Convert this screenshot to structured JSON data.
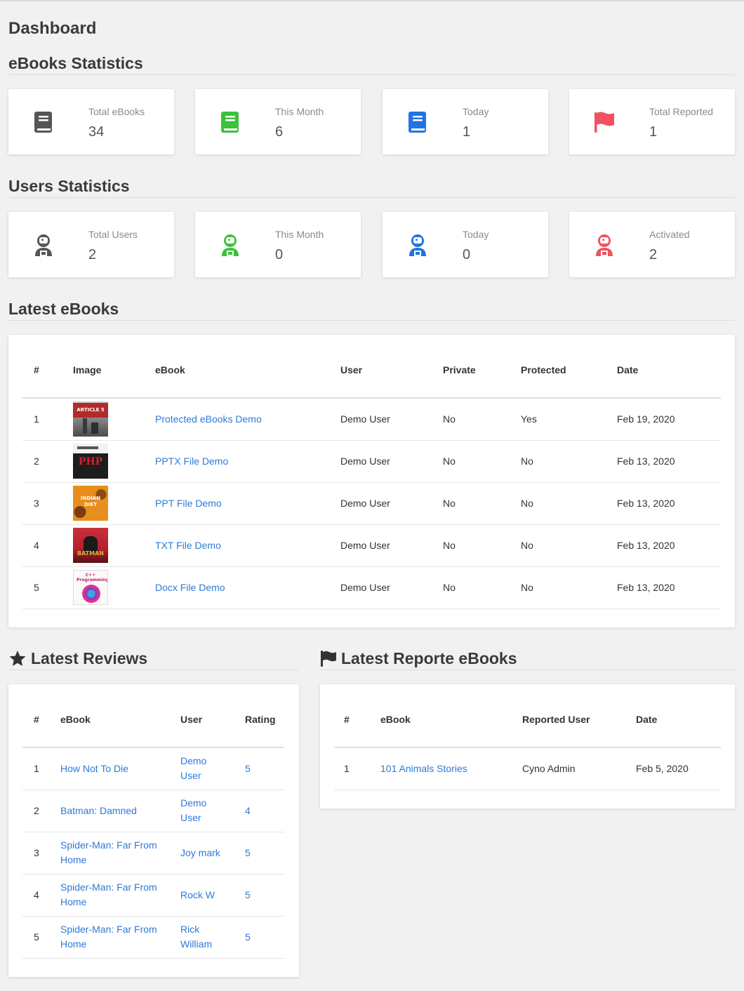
{
  "page_title": "Dashboard",
  "ebooks_stats": {
    "title": "eBooks Statistics",
    "cards": [
      {
        "label": "Total eBooks",
        "value": "34",
        "icon": "book-icon",
        "color": "#555555"
      },
      {
        "label": "This Month",
        "value": "6",
        "icon": "book-icon",
        "color": "#3cc13b"
      },
      {
        "label": "Today",
        "value": "1",
        "icon": "book-icon",
        "color": "#2173e4"
      },
      {
        "label": "Total Reported",
        "value": "1",
        "icon": "flag-icon",
        "color": "#f0525f"
      }
    ]
  },
  "users_stats": {
    "title": "Users Statistics",
    "cards": [
      {
        "label": "Total Users",
        "value": "2",
        "icon": "user-astronaut-icon",
        "color": "#555555"
      },
      {
        "label": "This Month",
        "value": "0",
        "icon": "user-astronaut-icon",
        "color": "#3cc13b"
      },
      {
        "label": "Today",
        "value": "0",
        "icon": "user-astronaut-icon",
        "color": "#2173e4"
      },
      {
        "label": "Activated",
        "value": "2",
        "icon": "user-astronaut-icon",
        "color": "#f0525f"
      }
    ]
  },
  "latest_ebooks": {
    "title": "Latest eBooks",
    "columns": [
      "#",
      "Image",
      "eBook",
      "User",
      "Private",
      "Protected",
      "Date"
    ],
    "rows": [
      {
        "num": "1",
        "image": "Article 5 cover",
        "cover_text": "ARTICLE 5",
        "ebook": "Protected eBooks Demo",
        "user": "Demo User",
        "private": "No",
        "protected": "Yes",
        "date": "Feb 19, 2020"
      },
      {
        "num": "2",
        "image": "PHP cover",
        "cover_text": "PHP",
        "ebook": "PPTX File Demo",
        "user": "Demo User",
        "private": "No",
        "protected": "No",
        "date": "Feb 13, 2020"
      },
      {
        "num": "3",
        "image": "Indian Diet cover",
        "cover_text": "INDIAN DIET",
        "ebook": "PPT File Demo",
        "user": "Demo User",
        "private": "No",
        "protected": "No",
        "date": "Feb 13, 2020"
      },
      {
        "num": "4",
        "image": "Batman cover",
        "cover_text": "BATMAN",
        "ebook": "TXT File Demo",
        "user": "Demo User",
        "private": "No",
        "protected": "No",
        "date": "Feb 13, 2020"
      },
      {
        "num": "5",
        "image": "C++ Programming cover",
        "cover_text": "C++ Programming",
        "ebook": "Docx File Demo",
        "user": "Demo User",
        "private": "No",
        "protected": "No",
        "date": "Feb 13, 2020"
      }
    ]
  },
  "latest_reviews": {
    "title": "Latest Reviews",
    "columns": [
      "#",
      "eBook",
      "User",
      "Rating"
    ],
    "rows": [
      {
        "num": "1",
        "ebook": "How Not To Die",
        "user": "Demo User",
        "rating": "5"
      },
      {
        "num": "2",
        "ebook": "Batman: Damned",
        "user": "Demo User",
        "rating": "4"
      },
      {
        "num": "3",
        "ebook": "Spider-Man: Far From Home",
        "user": "Joy mark",
        "rating": "5"
      },
      {
        "num": "4",
        "ebook": "Spider-Man: Far From Home",
        "user": "Rock W",
        "rating": "5"
      },
      {
        "num": "5",
        "ebook": "Spider-Man: Far From Home",
        "user": "Rick William",
        "rating": "5"
      }
    ]
  },
  "latest_reported": {
    "title": "Latest Reporte eBooks",
    "columns": [
      "#",
      "eBook",
      "Reported User",
      "Date"
    ],
    "rows": [
      {
        "num": "1",
        "ebook": "101 Animals Stories",
        "user": "Cyno Admin",
        "date": "Feb 5, 2020"
      }
    ]
  }
}
